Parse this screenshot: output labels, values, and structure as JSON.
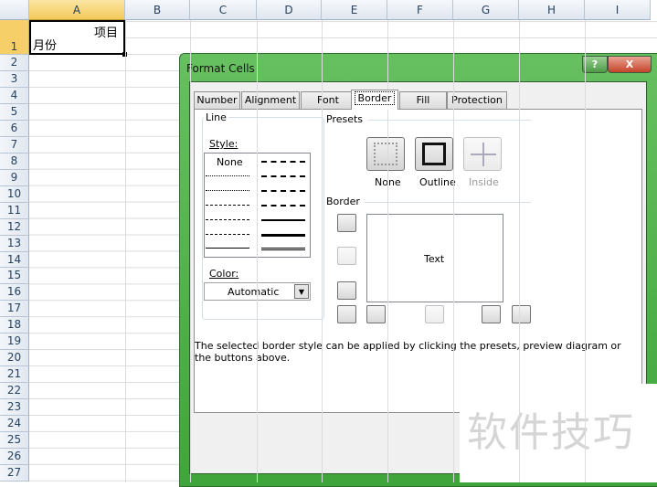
{
  "sheet": {
    "columns": [
      "A",
      "B",
      "C",
      "D",
      "E",
      "F",
      "G",
      "H",
      "I"
    ],
    "rows": [
      "1",
      "2",
      "3",
      "4",
      "5",
      "6",
      "7",
      "8",
      "9",
      "10",
      "11",
      "12",
      "13",
      "14",
      "15",
      "16",
      "17",
      "18",
      "19",
      "20",
      "21",
      "22",
      "23",
      "24",
      "25",
      "26",
      "27"
    ],
    "cell_A1_top": "项目",
    "cell_A1_bottom": "月份"
  },
  "dialog": {
    "title": "Format Cells",
    "help": "?",
    "close": "X",
    "tabs": [
      "Number",
      "Alignment",
      "Font",
      "Border",
      "Fill",
      "Protection"
    ],
    "active_tab": "Border",
    "line_group": "Line",
    "style_label": "Style:",
    "style_none": "None",
    "color_label": "Color:",
    "color_value": "Automatic",
    "presets_label": "Presets",
    "presets": [
      "None",
      "Outline",
      "Inside"
    ],
    "border_label": "Border",
    "preview_text": "Text",
    "hint": "The selected border style can be applied by clicking the presets, preview diagram or the buttons above."
  },
  "watermark": "软件技巧"
}
